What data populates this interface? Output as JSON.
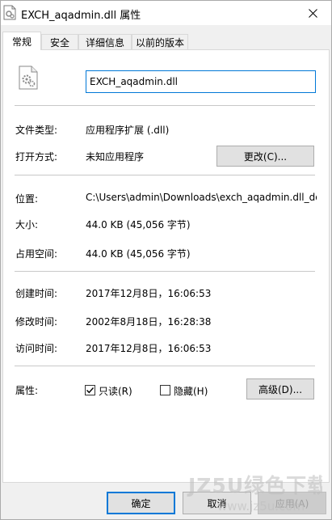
{
  "window": {
    "title": "EXCH_aqadmin.dll 属性"
  },
  "tabs": [
    {
      "label": "常规"
    },
    {
      "label": "安全"
    },
    {
      "label": "详细信息"
    },
    {
      "label": "以前的版本"
    }
  ],
  "general": {
    "file_name": "EXCH_aqadmin.dll",
    "file_type_label": "文件类型:",
    "file_type_value": "应用程序扩展 (.dll)",
    "open_with_label": "打开方式:",
    "open_with_value": "未知应用程序",
    "change_button": "更改(C)...",
    "location_label": "位置:",
    "location_value": "C:\\Users\\admin\\Downloads\\exch_aqadmin.dll_dow",
    "size_label": "大小:",
    "size_value": "44.0 KB (45,056 字节)",
    "disk_size_label": "占用空间:",
    "disk_size_value": "44.0 KB (45,056 字节)",
    "created_label": "创建时间:",
    "created_value": "2017年12月8日，16:06:53",
    "modified_label": "修改时间:",
    "modified_value": "2002年8月18日，16:28:38",
    "accessed_label": "访问时间:",
    "accessed_value": "2017年12月8日，16:06:53",
    "attributes_label": "属性:",
    "readonly_label": "只读(R)",
    "readonly_checked": true,
    "hidden_label": "隐藏(H)",
    "hidden_checked": false,
    "advanced_button": "高级(D)..."
  },
  "footer": {
    "ok_button": "确定",
    "cancel_button": "取消",
    "apply_button": "应用(A)"
  },
  "watermark": {
    "text": "JZ5U绿色下载",
    "url": "www.jz5u.com"
  },
  "colors": {
    "accent": "#0078d7",
    "window_bg": "#f0f0f0",
    "panel_bg": "#ffffff"
  }
}
